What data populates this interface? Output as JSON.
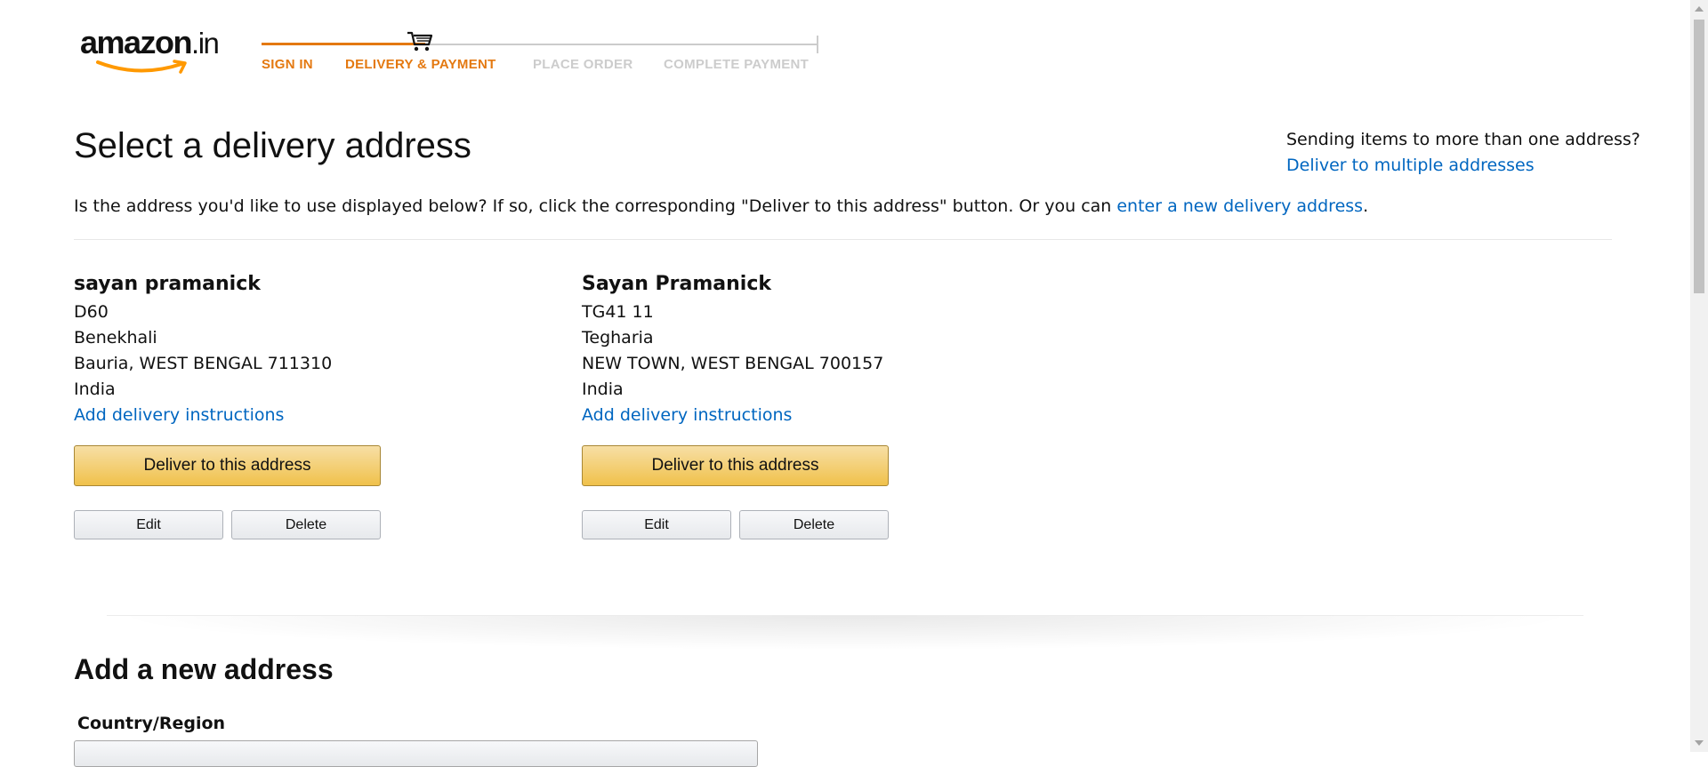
{
  "header": {
    "logo": {
      "text": "amazon",
      "suffix": ".in"
    },
    "steps": [
      {
        "label": "SIGN IN",
        "state": "active"
      },
      {
        "label": "DELIVERY & PAYMENT",
        "state": "active"
      },
      {
        "label": "PLACE ORDER",
        "state": "inactive"
      },
      {
        "label": "COMPLETE PAYMENT",
        "state": "inactive"
      }
    ],
    "progress_icon": "cart-icon"
  },
  "main": {
    "title": "Select a delivery address",
    "multi_address": {
      "question": "Sending items to more than one address?",
      "link": "Deliver to multiple addresses"
    },
    "intro": {
      "text": "Is the address you'd like to use displayed below? If so, click the corresponding \"Deliver to this address\" button. Or you can ",
      "link": "enter a new delivery address",
      "end": "."
    },
    "addresses": [
      {
        "name": "sayan pramanick",
        "lines": [
          "D60",
          "Benekhali",
          "Bauria, WEST BENGAL 711310",
          "India"
        ],
        "instructions_link": "Add delivery instructions",
        "deliver_label": "Deliver to this address",
        "edit_label": "Edit",
        "delete_label": "Delete"
      },
      {
        "name": "Sayan Pramanick",
        "lines": [
          "TG41 11",
          "Tegharia",
          "NEW TOWN, WEST BENGAL 700157",
          "India"
        ],
        "instructions_link": "Add delivery instructions",
        "deliver_label": "Deliver to this address",
        "edit_label": "Edit",
        "delete_label": "Delete"
      }
    ]
  },
  "new_address": {
    "title": "Add a new address",
    "country_label": "Country/Region"
  },
  "colors": {
    "accent": "#e47911",
    "link": "#0066c0",
    "primary_button": "#f0c14b",
    "inactive_step": "#cccccc"
  }
}
